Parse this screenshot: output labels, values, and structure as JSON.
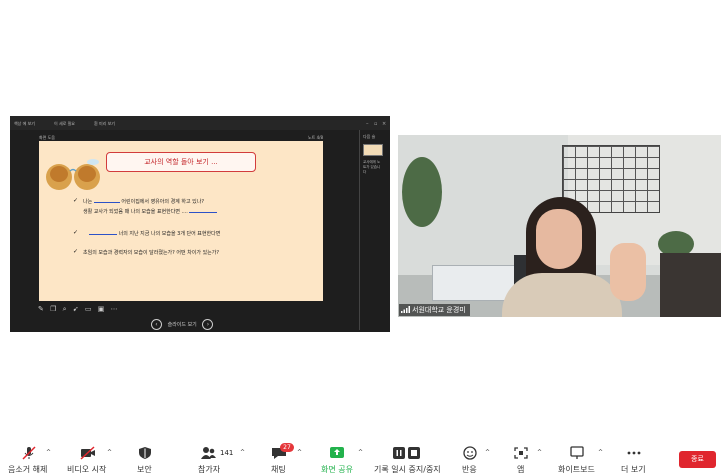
{
  "share": {
    "topbar": [
      "책상 에 보기",
      "이 세로 필요",
      "흰 미리 보기"
    ],
    "subbar_left": "화면 도움",
    "subbar_right": "노트 4/8",
    "slide": {
      "title": "교사의 역할 돌아 보기 ...",
      "line1": "나는",
      "line1b": "어린이집에서 영유아의 경계 하고 있나?",
      "line2": "생활 교사가 되었음 때 나의 모습을 표현한다면 ....",
      "line3": "너의 지난 지금 나의 모습을 3개 단어 표현한다면",
      "line4": "초임의 모습과 경력자의 모습이 달라졌는가? 어떤 차이가 있는가?",
      "check": "✓"
    },
    "nav_label": "슬라이드 보기",
    "side_label": "다음 슬",
    "side_note": "교사에게 노트가 있습니다"
  },
  "video": {
    "participant_name": "서원대학교 윤경미"
  },
  "toolbar": {
    "mute_label": "음소거 해제",
    "video_label": "비디오 시작",
    "security_label": "보안",
    "participants_label": "참가자",
    "participants_count": "141",
    "chat_label": "채팅",
    "chat_badge": "27",
    "share_label": "화면 공유",
    "pause_label": "기록 일시 중지/중지",
    "reactions_label": "반응",
    "apps_label": "앱",
    "whiteboard_label": "화이트보드",
    "more_label": "더 보기",
    "end_label": "종료"
  },
  "colors": {
    "share_green": "#22b24c",
    "end_red": "#e0262e",
    "badge_red": "#e5373b",
    "slide_bg": "#fde6c6",
    "title_red": "#c4272b"
  }
}
